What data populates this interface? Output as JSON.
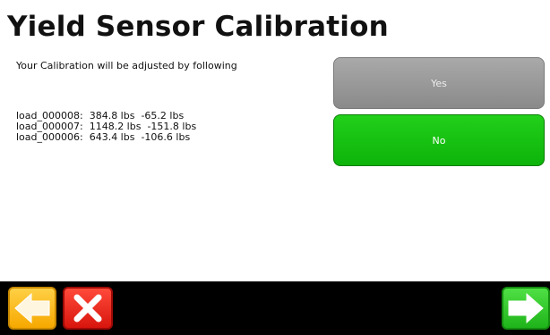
{
  "header": {
    "title": "Yield Sensor Calibration"
  },
  "info": {
    "message": "Your Calibration will be adjusted by following"
  },
  "adjustments": [
    {
      "text": "load_000008:  384.8 lbs  -65.2 lbs"
    },
    {
      "text": "load_000007:  1148.2 lbs  -151.8 lbs"
    },
    {
      "text": "load_000006:  643.4 lbs  -106.6 lbs"
    }
  ],
  "buttons": {
    "yes_label": "Yes",
    "no_label": "No"
  },
  "toolbar": {
    "back_icon": "left-arrow-icon",
    "cancel_icon": "close-x-icon",
    "next_icon": "right-arrow-icon"
  },
  "colors": {
    "yes_button": "#9b9b9b",
    "no_button": "#19c414",
    "bottom_bar": "#000000",
    "back_button": "#f8b400",
    "cancel_button": "#e2231a",
    "next_button": "#2fc829"
  }
}
